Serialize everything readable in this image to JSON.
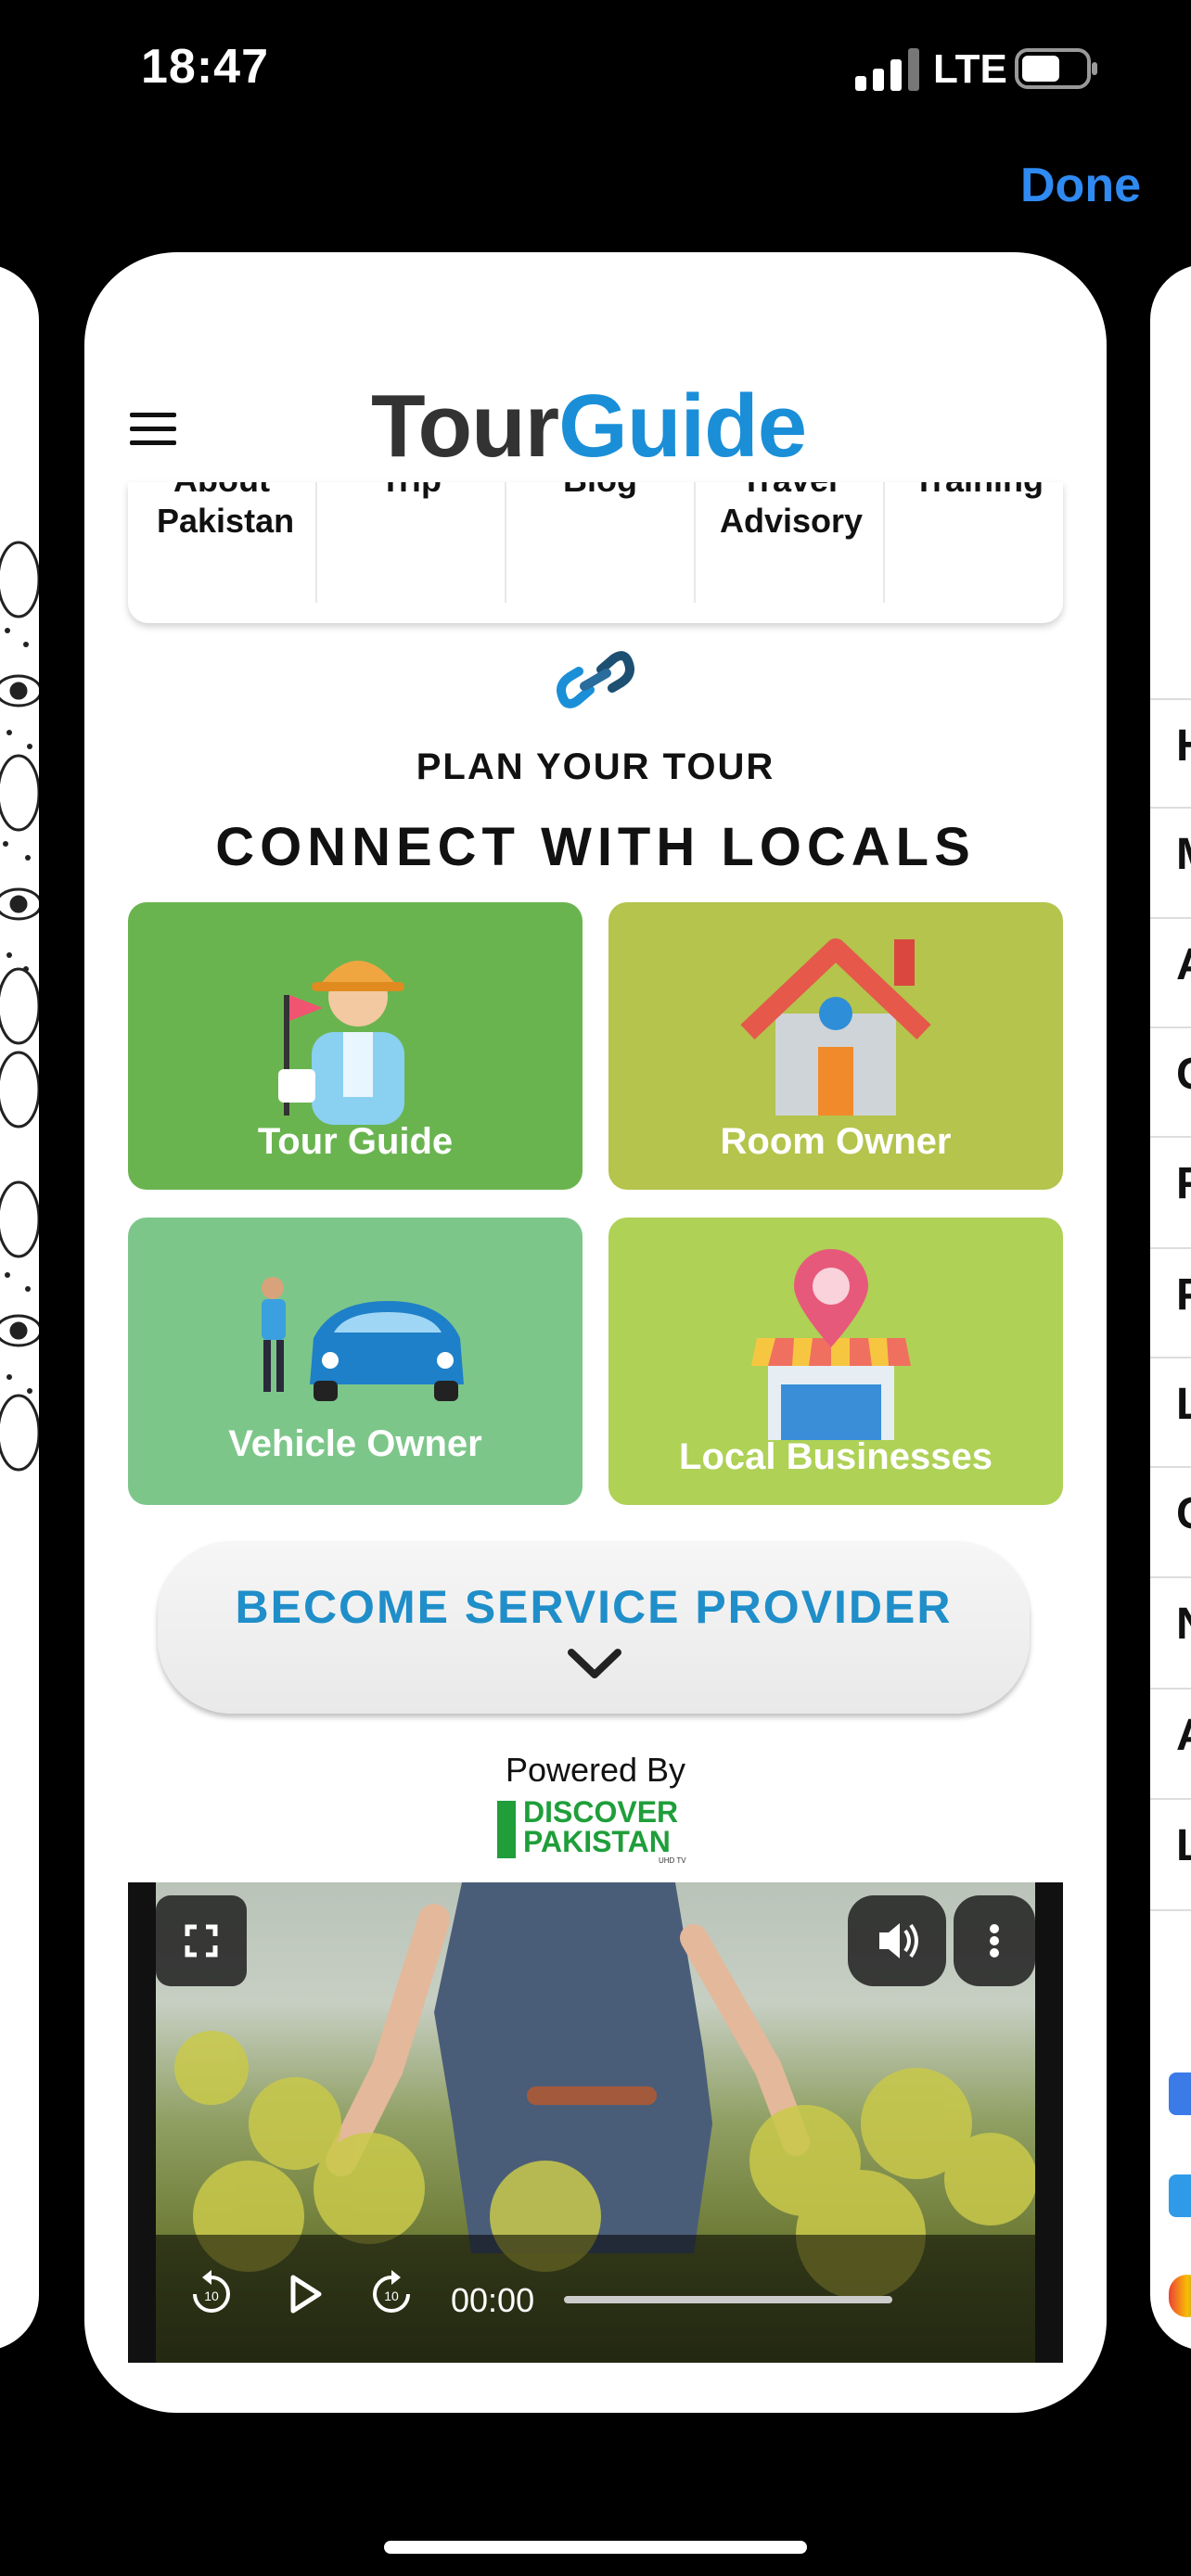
{
  "status_bar": {
    "time": "18:47",
    "network": "LTE"
  },
  "header": {
    "done_label": "Done"
  },
  "brand": {
    "tour": "Tour",
    "guide": "Guide"
  },
  "menu": {
    "items": [
      {
        "label": "About Pakistan"
      },
      {
        "label": "Trip"
      },
      {
        "label": "Blog"
      },
      {
        "label": "Travel Advisory"
      },
      {
        "label": "Training"
      }
    ]
  },
  "section": {
    "subtitle": "PLAN YOUR TOUR",
    "title": "CONNECT WITH LOCALS"
  },
  "tiles": [
    {
      "label": "Tour Guide",
      "color": "#6ab450",
      "icon": "tour-guide-icon"
    },
    {
      "label": "Room Owner",
      "color": "#b4c44c",
      "icon": "house-icon"
    },
    {
      "label": "Vehicle Owner",
      "color": "#7dc68a",
      "icon": "car-icon"
    },
    {
      "label": "Local Businesses",
      "color": "#aed156",
      "icon": "shop-location-icon"
    }
  ],
  "become_provider": {
    "label": "BECOME SERVICE PROVIDER"
  },
  "powered_by": {
    "label": "Powered By",
    "brand_line1": "DISCOVER",
    "brand_line2": "PAKISTAN",
    "brand_sub": "UHD TV"
  },
  "video": {
    "time": "00:00"
  },
  "right_card": {
    "letters": [
      "H",
      "M",
      "A",
      "C",
      "F",
      "P",
      "L",
      "C",
      "N",
      "A",
      "L"
    ]
  }
}
